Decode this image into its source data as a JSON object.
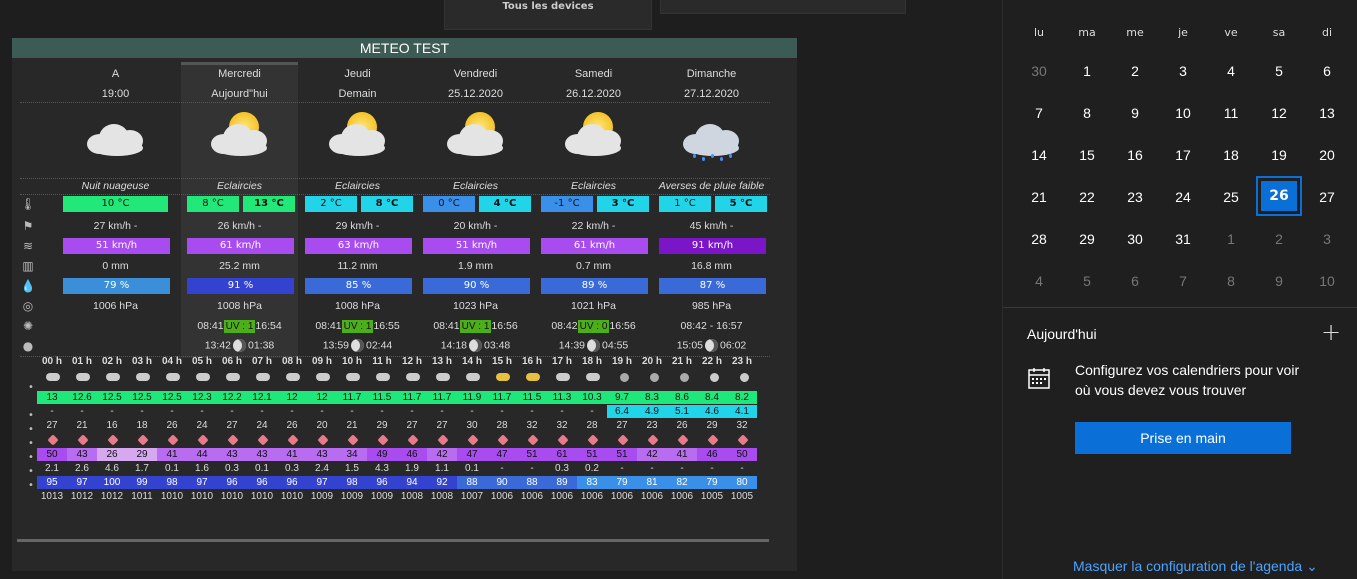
{
  "devices_label": "Tous les devices",
  "widget_title": "METEO TEST",
  "days": [
    {
      "name": "A",
      "sub": "19:00",
      "desc": "Nuit nuageuse",
      "tmin": "10 °C",
      "tmax": "",
      "wind": "27 km/h -",
      "gust": "51 km/h",
      "rain": "0 mm",
      "hum": "79 %",
      "press": "1006 hPa",
      "sun": "",
      "uv": "",
      "moon": "",
      "icon": "cloud"
    },
    {
      "name": "Mercredi",
      "sub": "Aujourd\"hui",
      "desc": "Eclaircies",
      "tmin": "8 °C",
      "tmax": "13 °C",
      "wind": "26 km/h -",
      "gust": "61 km/h",
      "rain": "25.2 mm",
      "hum": "91 %",
      "press": "1008 hPa",
      "sun_rise": "08:41",
      "sun_set": "16:54",
      "uv": "UV : 1",
      "moon_rise": "13:42",
      "moon_set": "01:38",
      "icon": "sun"
    },
    {
      "name": "Jeudi",
      "sub": "Demain",
      "desc": "Eclaircies",
      "tmin": "2 °C",
      "tmax": "8 °C",
      "wind": "29 km/h -",
      "gust": "63 km/h",
      "rain": "11.2 mm",
      "hum": "85 %",
      "press": "1008 hPa",
      "sun_rise": "08:41",
      "sun_set": "16:55",
      "uv": "UV : 1",
      "moon_rise": "13:59",
      "moon_set": "02:44",
      "icon": "sun"
    },
    {
      "name": "Vendredi",
      "sub": "25.12.2020",
      "desc": "Eclaircies",
      "tmin": "0 °C",
      "tmax": "4 °C",
      "wind": "20 km/h -",
      "gust": "51 km/h",
      "rain": "1.9 mm",
      "hum": "90 %",
      "press": "1023 hPa",
      "sun_rise": "08:41",
      "sun_set": "16:56",
      "uv": "UV : 1",
      "moon_rise": "14:18",
      "moon_set": "03:48",
      "icon": "sun"
    },
    {
      "name": "Samedi",
      "sub": "26.12.2020",
      "desc": "Eclaircies",
      "tmin": "-1 °C",
      "tmax": "3 °C",
      "wind": "22 km/h -",
      "gust": "61 km/h",
      "rain": "0.7 mm",
      "hum": "89 %",
      "press": "1021 hPa",
      "sun_rise": "08:42",
      "sun_set": "16:56",
      "uv": "UV : 0",
      "moon_rise": "14:39",
      "moon_set": "04:55",
      "icon": "sun"
    },
    {
      "name": "Dimanche",
      "sub": "27.12.2020",
      "desc": "Averses de pluie faible",
      "tmin": "1 °C",
      "tmax": "5 °C",
      "wind": "45 km/h -",
      "gust": "91 km/h",
      "rain": "16.8 mm",
      "hum": "87 %",
      "press": "985 hPa",
      "sun_rise": "08:42 - 16:57",
      "sun_set": "",
      "uv": "",
      "moon_rise": "15:05",
      "moon_set": "06:02",
      "icon": "rain"
    }
  ],
  "hours": [
    "00 h",
    "01 h",
    "02 h",
    "03 h",
    "04 h",
    "05 h",
    "06 h",
    "07 h",
    "08 h",
    "09 h",
    "10 h",
    "11 h",
    "12 h",
    "13 h",
    "14 h",
    "15 h",
    "16 h",
    "17 h",
    "18 h",
    "19 h",
    "20 h",
    "21 h",
    "22 h",
    "23 h"
  ],
  "h_temp": [
    "13",
    "12.6",
    "12.5",
    "12.5",
    "12.5",
    "12.3",
    "12.2",
    "12.1",
    "12",
    "12",
    "11.7",
    "11.5",
    "11.7",
    "11.7",
    "11.9",
    "11.7",
    "11.5",
    "11.3",
    "10.3",
    "9.7",
    "8.3",
    "8.6",
    "8.4",
    "8.2"
  ],
  "h_temp2": [
    "-",
    "-",
    "-",
    "-",
    "-",
    "-",
    "-",
    "-",
    "-",
    "-",
    "-",
    "-",
    "-",
    "-",
    "-",
    "-",
    "-",
    "-",
    "-",
    "6.4",
    "4.9",
    "5.1",
    "4.6",
    "4.1"
  ],
  "h_wind": [
    "27",
    "21",
    "16",
    "18",
    "26",
    "24",
    "27",
    "24",
    "26",
    "20",
    "21",
    "29",
    "27",
    "27",
    "30",
    "28",
    "32",
    "32",
    "28",
    "27",
    "23",
    "26",
    "29",
    "32"
  ],
  "h_gust": [
    "50",
    "43",
    "26",
    "29",
    "41",
    "44",
    "43",
    "43",
    "41",
    "43",
    "34",
    "49",
    "46",
    "42",
    "47",
    "47",
    "51",
    "61",
    "51",
    "51",
    "42",
    "41",
    "46",
    "50"
  ],
  "h_rain": [
    "2.1",
    "2.6",
    "4.6",
    "1.7",
    "0.1",
    "1.6",
    "0.3",
    "0.1",
    "0.3",
    "2.4",
    "1.5",
    "4.3",
    "1.9",
    "1.1",
    "0.1",
    "-",
    "-",
    "0.3",
    "0.2",
    "-",
    "-",
    "-",
    "-",
    "-"
  ],
  "h_hum": [
    "95",
    "97",
    "100",
    "99",
    "98",
    "97",
    "96",
    "96",
    "96",
    "97",
    "98",
    "96",
    "94",
    "92",
    "88",
    "90",
    "88",
    "89",
    "83",
    "79",
    "81",
    "82",
    "79",
    "80"
  ],
  "h_press": [
    "1013",
    "1012",
    "1012",
    "1011",
    "1010",
    "1010",
    "1010",
    "1010",
    "1010",
    "1009",
    "1009",
    "1009",
    "1008",
    "1008",
    "1007",
    "1006",
    "1006",
    "1006",
    "1006",
    "1006",
    "1006",
    "1006",
    "1005",
    "1005"
  ],
  "calendar": {
    "weekdays": [
      "lu",
      "ma",
      "me",
      "je",
      "ve",
      "sa",
      "di"
    ],
    "weeks": [
      [
        "30",
        "1",
        "2",
        "3",
        "4",
        "5",
        "6"
      ],
      [
        "7",
        "8",
        "9",
        "10",
        "11",
        "12",
        "13"
      ],
      [
        "14",
        "15",
        "16",
        "17",
        "18",
        "19",
        "20"
      ],
      [
        "21",
        "22",
        "23",
        "24",
        "25",
        "26",
        "27"
      ],
      [
        "28",
        "29",
        "30",
        "31",
        "1",
        "2",
        "3"
      ],
      [
        "4",
        "5",
        "6",
        "7",
        "8",
        "9",
        "10"
      ]
    ]
  },
  "panel": {
    "today_label": "Aujourd'hui",
    "message": "Configurez vos calendriers pour voir où vous devez vous trouver",
    "button": "Prise en main",
    "link": "Masquer la configuration de l'agenda"
  },
  "colors": {
    "accent": "#0a6fd6",
    "title_bar": "#3d5b55",
    "green": "#22e87a",
    "cyan": "#22d4e8",
    "blue": "#3a7bd5",
    "purple": "#a84cf0"
  }
}
